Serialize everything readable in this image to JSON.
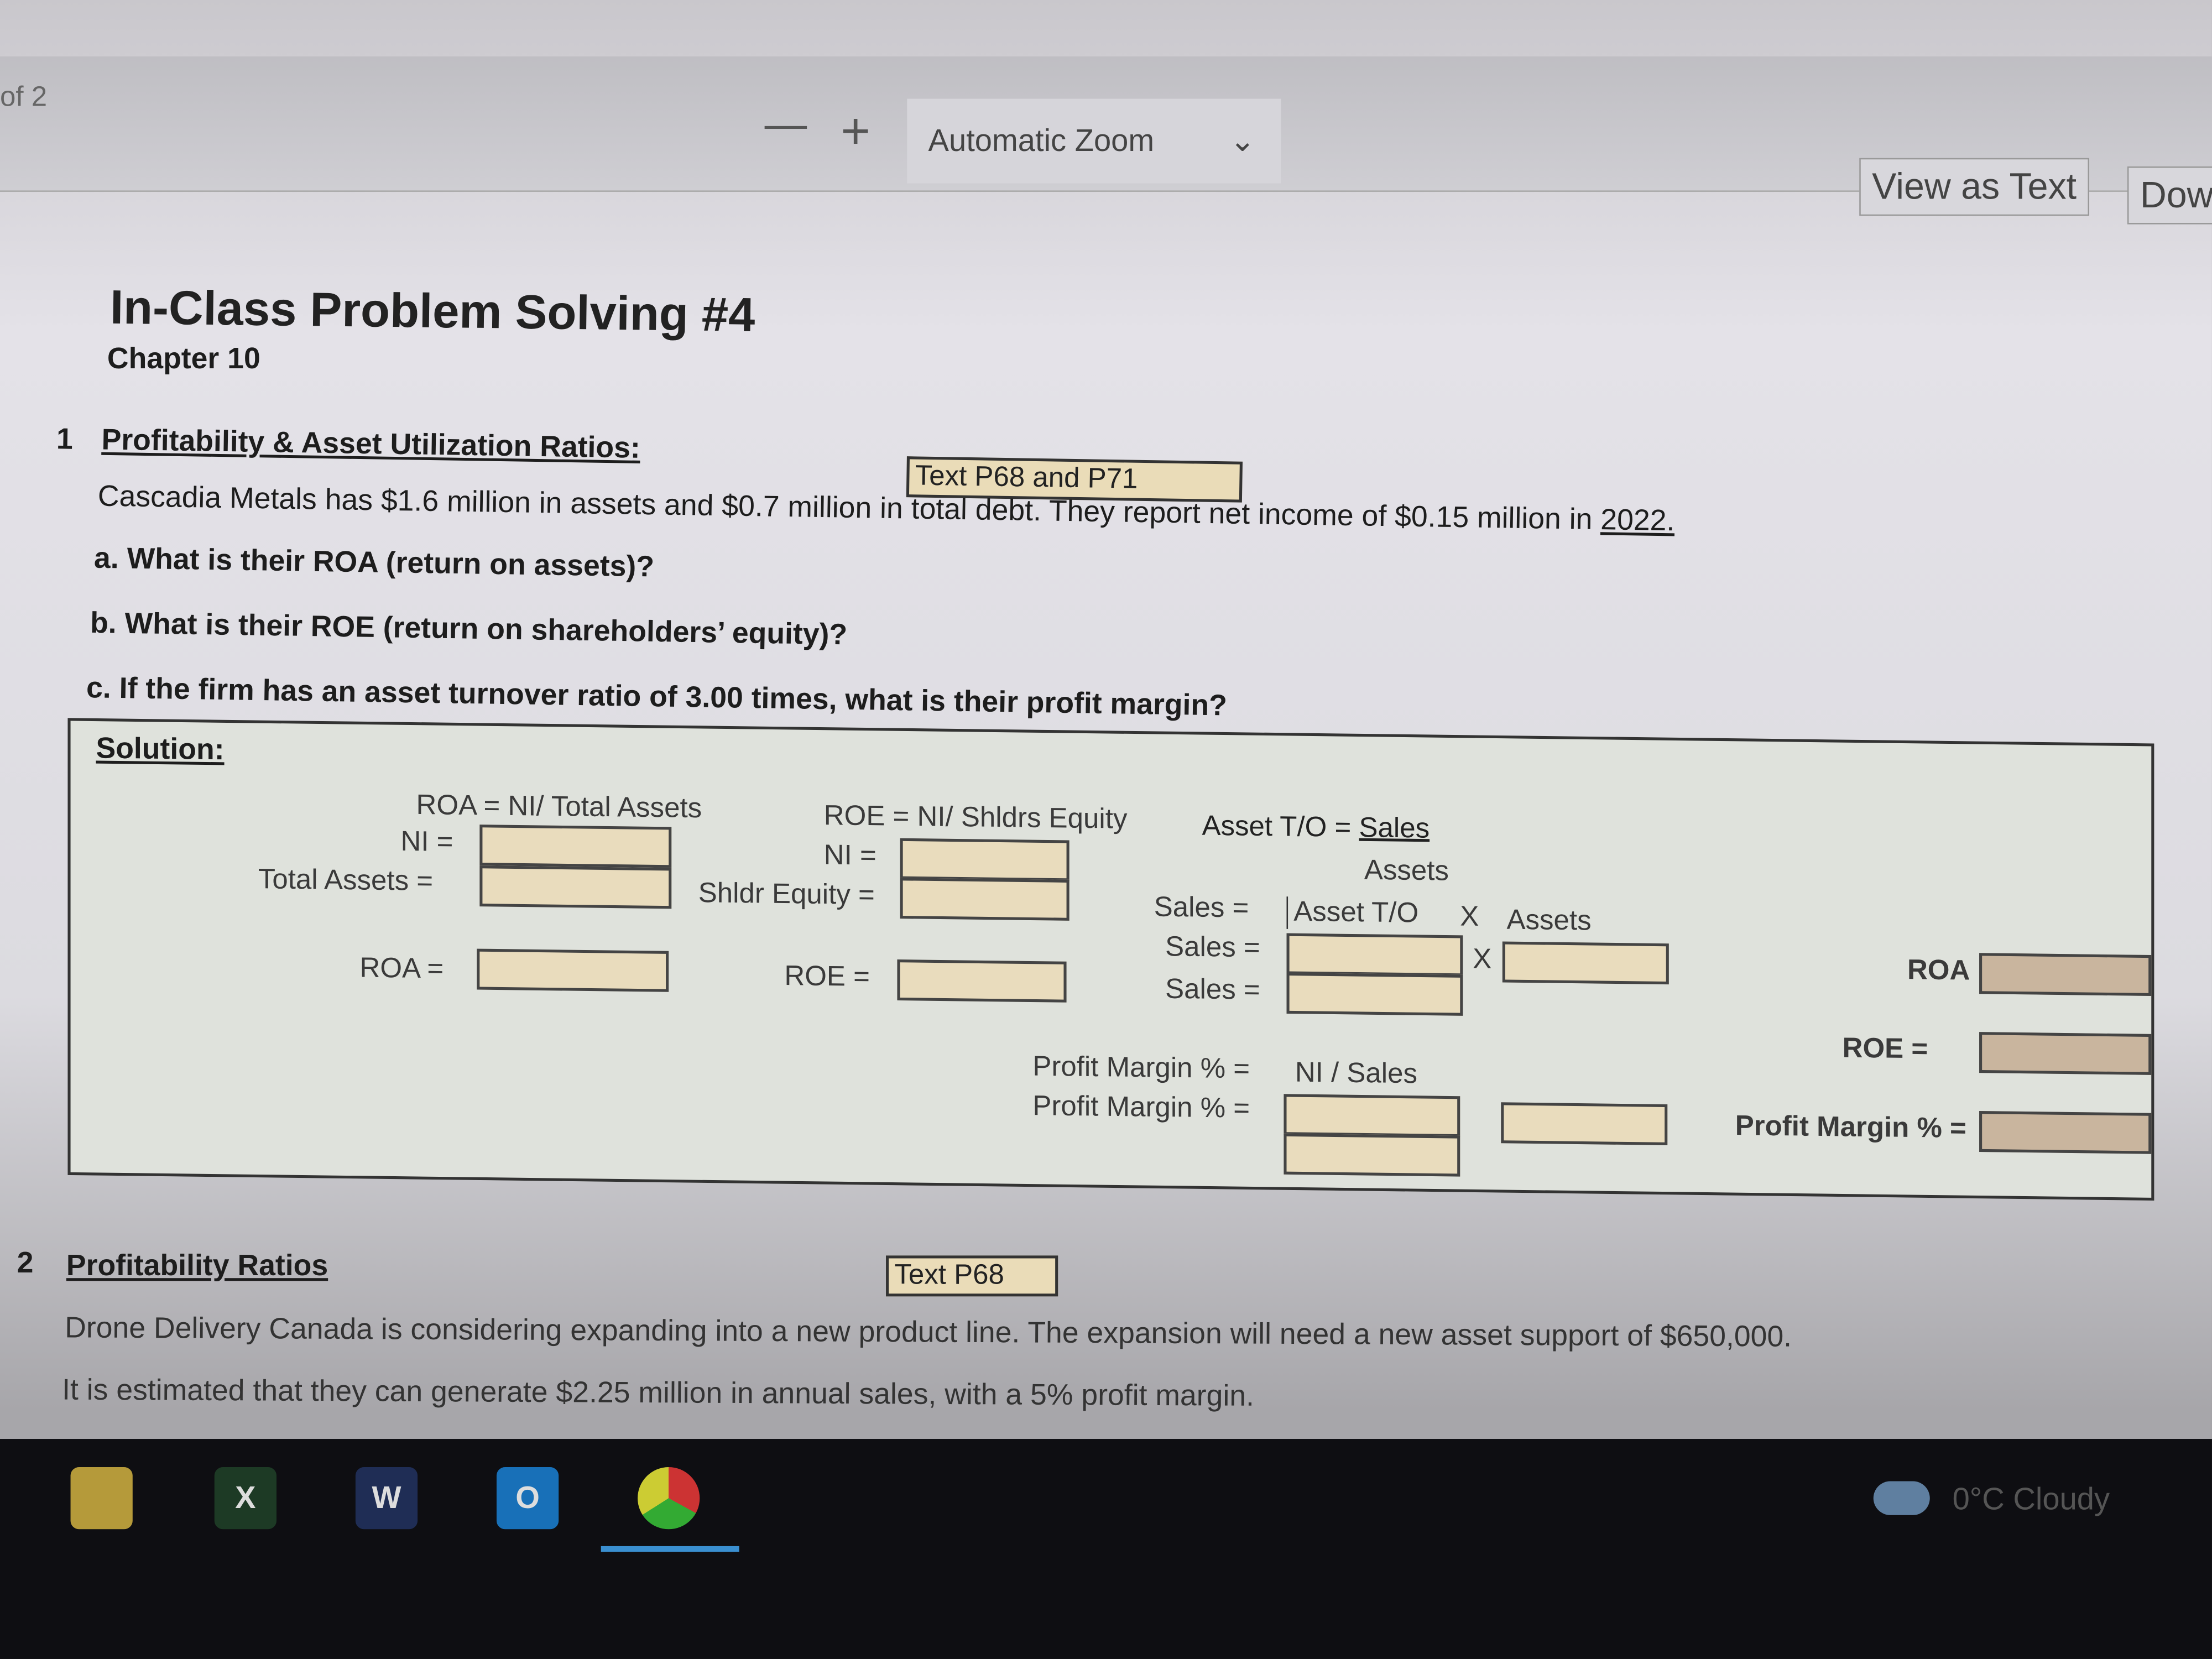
{
  "viewer": {
    "page_of": "of 2",
    "zoom_out": "—",
    "zoom_in": "+",
    "zoom_select": "Automatic Zoom",
    "view_as_text": "View as Text",
    "download": "Dow"
  },
  "header": {
    "title": "In-Class Problem Solving #4",
    "subtitle": "Chapter 10"
  },
  "q1": {
    "number": "1",
    "heading": "Profitability & Asset Utilization Ratios:",
    "reference": "Text P68 and P71",
    "prompt_a": "Cascadia Metals has $1.6 million in assets and $0.7 million in total debt. They report net income of $0.15 million in ",
    "prompt_year": "2022.",
    "a": "a. What is their ROA (return on assets)?",
    "b": "b. What is their ROE (return on shareholders’ equity)?",
    "c": "c. If the firm has an asset turnover ratio of 3.00 times, what is their profit margin?"
  },
  "solution": {
    "title": "Solution:",
    "roa_formula": "ROA = NI/ Total Assets",
    "roe_formula": "ROE = NI/ Shldrs Equity",
    "ato_formula": "Asset T/O = ",
    "ato_sales": "Sales",
    "ato_assets": "Assets",
    "ni": "NI =",
    "total_assets": "Total Assets =",
    "shldr_equity": "Shldr Equity =",
    "roa": "ROA =",
    "roe": "ROE =",
    "sales": "Sales =",
    "asset_to": "Asset T/O",
    "x": "X",
    "assets": "Assets",
    "pm_formula": "Profit Margin % =",
    "pm_formula_rhs": "NI / Sales",
    "pm": "Profit Margin % =",
    "sum_roa": "ROA",
    "sum_roe": "ROE =",
    "sum_pm": "Profit Margin % ="
  },
  "q2": {
    "number": "2",
    "heading": "Profitability Ratios",
    "reference": "Text P68",
    "line1": "Drone Delivery Canada is considering expanding into a new product line. The expansion will need a new asset support of $650,000.",
    "line2": "It is estimated that they can generate $2.25 million in annual sales, with a 5% profit margin."
  },
  "taskbar": {
    "apps": [
      "file-explorer",
      "excel",
      "word",
      "outlook",
      "chrome"
    ],
    "excel_letter": "X",
    "word_letter": "W",
    "outlook_letter": "O",
    "weather": "0°C  Cloudy"
  }
}
